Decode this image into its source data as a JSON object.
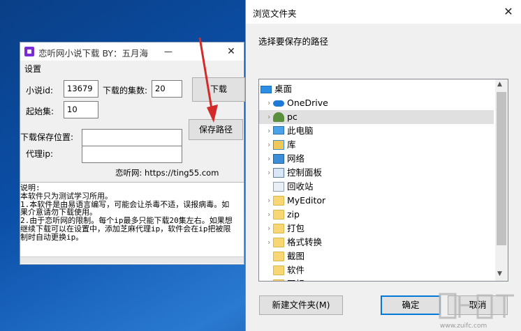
{
  "app": {
    "title": "恋听网小说下载 BY：五月海",
    "min": "—",
    "close": "✕",
    "menu": "设置",
    "novel_id_label": "小说id:",
    "novel_id_value": "13679",
    "episodes_label": "下载的集数:",
    "episodes_value": "20",
    "download_button": "下载",
    "start_label": "起始集:",
    "start_value": "10",
    "save_path_label": "下载保存位置:",
    "save_path_value": "",
    "save_path_button": "保存路径",
    "proxy_label": "代理ip:",
    "proxy_value": "",
    "site": "恋听网: https://ting55.com",
    "notes": "说明:\n本软件只为测试学习所用。\n1.本软件是由易语言编写，可能会让杀毒不适，误报病毒。如\n果介意请勿下载使用。\n2.由于恋听网的限制。每个ip最多只能下载20集左右。如果想\n继续下载可以在设置中，添加芝麻代理ip，软件会在ip把被限\n制时自动更换ip。"
  },
  "dialog": {
    "title": "浏览文件夹",
    "close": "✕",
    "prompt": "选择要保存的路径",
    "tree": [
      {
        "label": "桌面",
        "icon": "desktop-icon",
        "chev": ""
      },
      {
        "label": "OneDrive",
        "icon": "cloud-icon",
        "chev": "›"
      },
      {
        "label": "pc",
        "icon": "user-icon",
        "chev": "›",
        "selected": true
      },
      {
        "label": "此电脑",
        "icon": "computer-icon",
        "chev": "›"
      },
      {
        "label": "库",
        "icon": "library-icon",
        "chev": "›"
      },
      {
        "label": "网络",
        "icon": "network-icon",
        "chev": "›"
      },
      {
        "label": "控制面板",
        "icon": "control-panel-icon",
        "chev": "›"
      },
      {
        "label": "回收站",
        "icon": "recycle-bin-icon",
        "chev": ""
      },
      {
        "label": "MyEditor",
        "icon": "folder-icon",
        "chev": "›"
      },
      {
        "label": "zip",
        "icon": "folder-icon",
        "chev": "›"
      },
      {
        "label": "打包",
        "icon": "folder-icon",
        "chev": "›"
      },
      {
        "label": "格式转换",
        "icon": "folder-icon",
        "chev": "›"
      },
      {
        "label": "截图",
        "icon": "folder-icon",
        "chev": ""
      },
      {
        "label": "软件",
        "icon": "folder-icon",
        "chev": ""
      },
      {
        "label": "图标",
        "icon": "folder-icon",
        "chev": ""
      }
    ],
    "new_folder_button": "新建文件夹(M)",
    "ok_button": "确定",
    "cancel_button": "取消"
  },
  "watermark": {
    "text": "www.zuifc.com"
  },
  "colors": {
    "arrow": "#d42a2a",
    "accent": "#0078d7"
  }
}
